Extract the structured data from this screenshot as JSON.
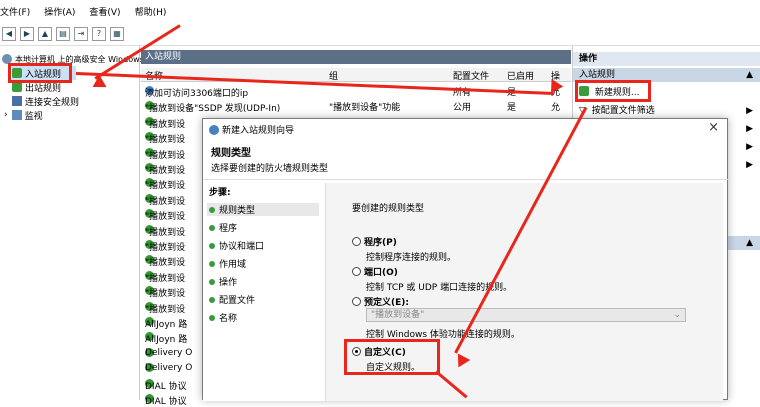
{
  "menu": [
    "文件(F)",
    "操作(A)",
    "查看(V)",
    "帮助(H)"
  ],
  "tree": {
    "root": "本地计算机 上的高级安全 Windows",
    "items": [
      "入站规则",
      "出站规则",
      "连接安全规则",
      "监视"
    ]
  },
  "center": {
    "title": "入站规则",
    "columns": [
      "名称",
      "组",
      "配置文件",
      "已启用",
      "操"
    ],
    "rules": [
      {
        "name": "添加可访问3306端口的ip",
        "group": "",
        "profile": "所有",
        "enabled": "是",
        "op": "允"
      },
      {
        "name": "\"播放到设备\"SSDP 发现(UDP-In)",
        "group": "\"播放到设备\"功能",
        "profile": "公用",
        "enabled": "是",
        "op": "允"
      },
      {
        "name": "\"播放到设",
        "group": "",
        "profile": "",
        "enabled": "",
        "op": ""
      },
      {
        "name": "\"播放到设",
        "group": "",
        "profile": "",
        "enabled": "",
        "op": ""
      },
      {
        "name": "\"播放到设",
        "group": "",
        "profile": "",
        "enabled": "",
        "op": ""
      },
      {
        "name": "\"播放到设",
        "group": "",
        "profile": "",
        "enabled": "",
        "op": ""
      },
      {
        "name": "\"播放到设",
        "group": "",
        "profile": "",
        "enabled": "",
        "op": ""
      },
      {
        "name": "\"播放到设",
        "group": "",
        "profile": "",
        "enabled": "",
        "op": ""
      },
      {
        "name": "\"播放到设",
        "group": "",
        "profile": "",
        "enabled": "",
        "op": ""
      },
      {
        "name": "\"播放到设",
        "group": "",
        "profile": "",
        "enabled": "",
        "op": ""
      },
      {
        "name": "\"播放到设",
        "group": "",
        "profile": "",
        "enabled": "",
        "op": ""
      },
      {
        "name": "\"播放到设",
        "group": "",
        "profile": "",
        "enabled": "",
        "op": ""
      },
      {
        "name": "\"播放到设",
        "group": "",
        "profile": "",
        "enabled": "",
        "op": ""
      },
      {
        "name": "\"播放到设",
        "group": "",
        "profile": "",
        "enabled": "",
        "op": ""
      },
      {
        "name": "\"播放到设",
        "group": "",
        "profile": "",
        "enabled": "",
        "op": ""
      },
      {
        "name": "AllJoyn 路",
        "group": "",
        "profile": "",
        "enabled": "",
        "op": ""
      },
      {
        "name": "AllJoyn 路",
        "group": "",
        "profile": "",
        "enabled": "",
        "op": ""
      },
      {
        "name": "Delivery O",
        "group": "",
        "profile": "",
        "enabled": "",
        "op": ""
      },
      {
        "name": "Delivery O",
        "group": "",
        "profile": "",
        "enabled": "",
        "op": ""
      },
      {
        "name": "DIAL 协议",
        "group": "",
        "profile": "",
        "enabled": "",
        "op": ""
      },
      {
        "name": "DIAL 协议",
        "group": "",
        "profile": "",
        "enabled": "",
        "op": ""
      }
    ]
  },
  "actions": {
    "title": "操作",
    "section": "入站规则",
    "items": [
      "新建规则...",
      "按配置文件筛选"
    ]
  },
  "dialog": {
    "title": "新建入站规则向导",
    "heading": "规则类型",
    "subheading": "选择要创建的防火墙规则类型",
    "steps_label": "步骤:",
    "steps": [
      "规则类型",
      "程序",
      "协议和端口",
      "作用域",
      "操作",
      "配置文件",
      "名称"
    ],
    "prompt": "要创建的规则类型",
    "options": [
      {
        "label": "程序(P)",
        "desc": "控制程序连接的规则。"
      },
      {
        "label": "端口(O)",
        "desc": "控制 TCP 或 UDP 端口连接的规则。"
      },
      {
        "label": "预定义(E):",
        "desc": "控制 Windows 体验功能连接的规则。"
      },
      {
        "label": "自定义(C)",
        "desc": "自定义规则。"
      }
    ],
    "predefined_value": "\"播放到设备\"",
    "close": "×"
  },
  "colors": {
    "annotation": "#e8261b",
    "panel_header": "#5b6f87",
    "check": "#2f9a2f"
  }
}
